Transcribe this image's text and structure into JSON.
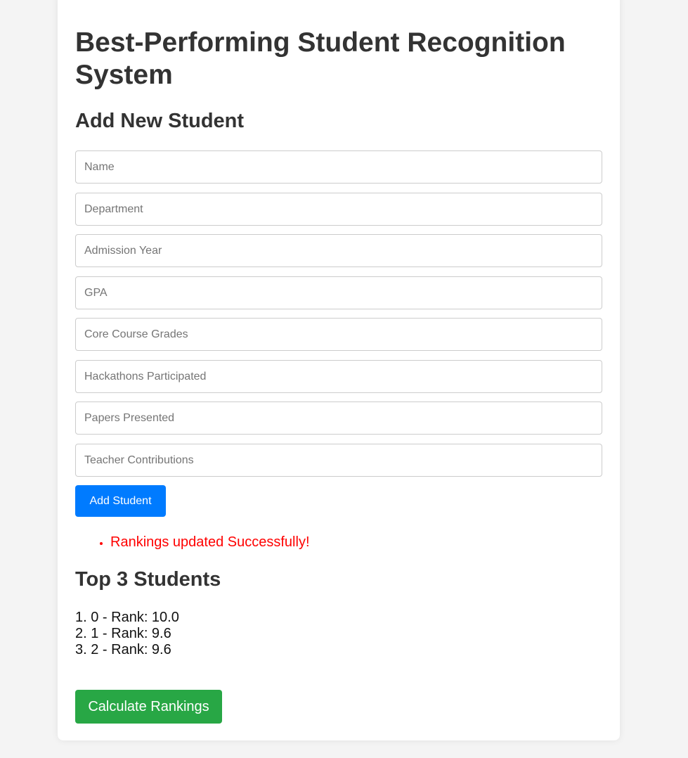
{
  "page": {
    "title": "Best-Performing Student Recognition System"
  },
  "form": {
    "heading": "Add New Student",
    "fields": [
      {
        "placeholder": "Name",
        "value": ""
      },
      {
        "placeholder": "Department",
        "value": ""
      },
      {
        "placeholder": "Admission Year",
        "value": ""
      },
      {
        "placeholder": "GPA",
        "value": ""
      },
      {
        "placeholder": "Core Course Grades",
        "value": ""
      },
      {
        "placeholder": "Hackathons Participated",
        "value": ""
      },
      {
        "placeholder": "Papers Presented",
        "value": ""
      },
      {
        "placeholder": "Teacher Contributions",
        "value": ""
      }
    ],
    "submit_label": "Add Student"
  },
  "messages": [
    "Rankings updated Successfully!"
  ],
  "top": {
    "heading": "Top 3 Students",
    "items": [
      "1. 0 - Rank: 10.0",
      "2. 1 - Rank: 9.6",
      "3. 2 - Rank: 9.6"
    ]
  },
  "actions": {
    "calculate_label": "Calculate Rankings"
  },
  "colors": {
    "background": "#f4f4f4",
    "card": "#ffffff",
    "primary_button": "#007bff",
    "success_button": "#28a745",
    "message_text": "#ff0000",
    "heading_text": "#333333"
  }
}
